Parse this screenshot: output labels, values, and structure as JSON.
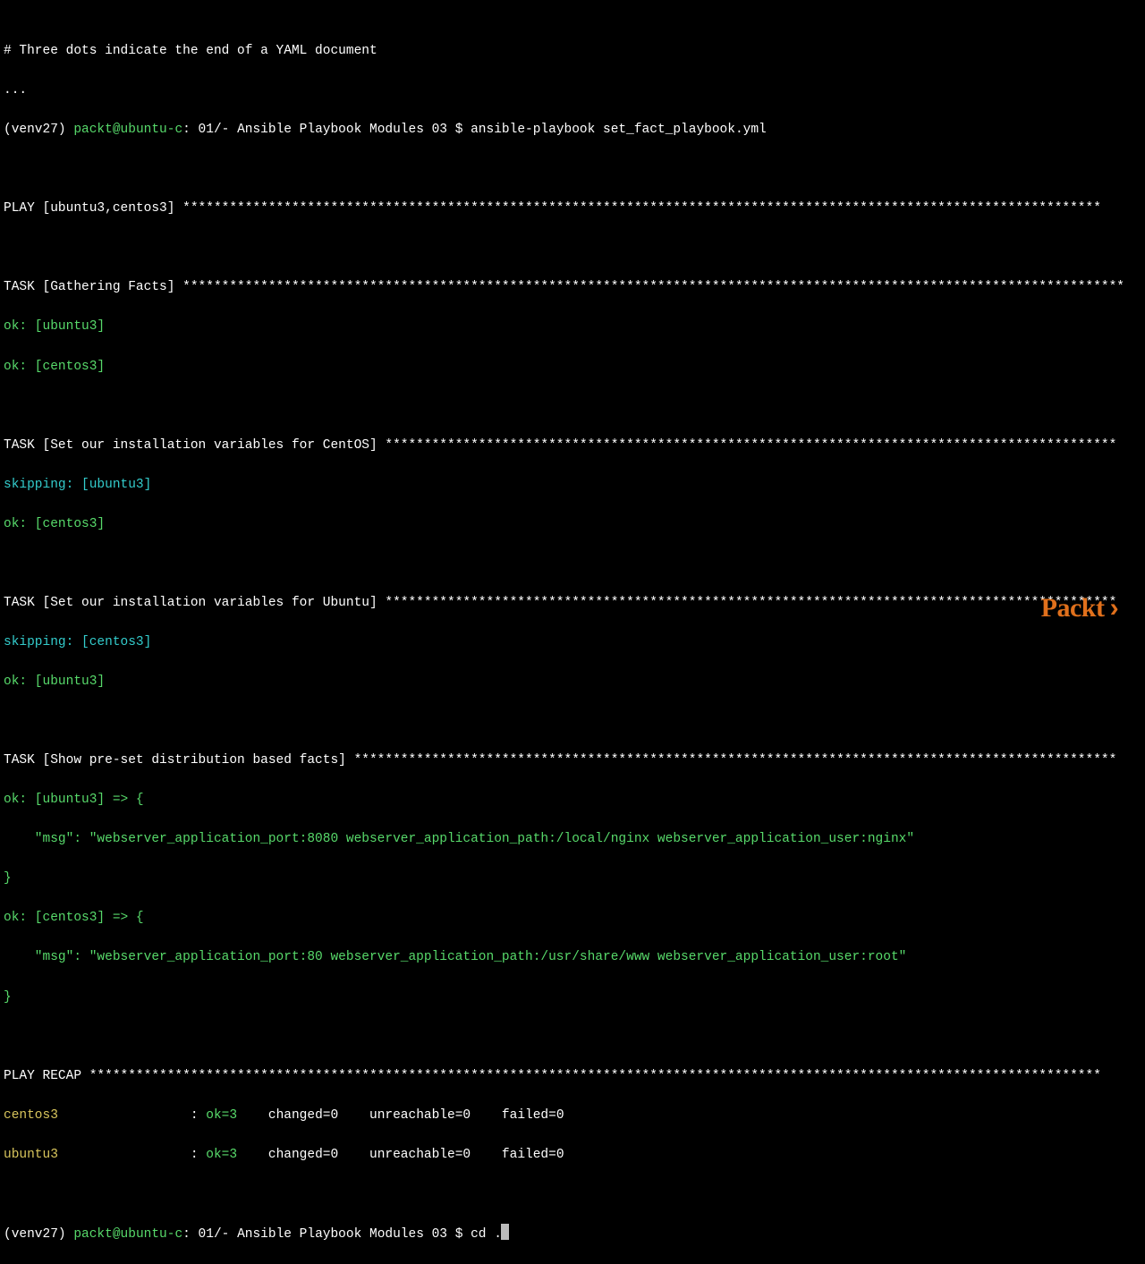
{
  "comment_line": "# Three dots indicate the end of a YAML document",
  "dots_line": "...",
  "prompt": {
    "venv": "(venv27) ",
    "user_host": "packt@ubuntu-c",
    "path_label": ": 01/- Ansible Playbook Modules 03 $ ",
    "command1": "ansible-playbook set_fact_playbook.yml",
    "command2": "cd ."
  },
  "play_header": "PLAY [ubuntu3,centos3] ",
  "task1": {
    "header": "TASK [Gathering Facts] ",
    "r1": "ok: [ubuntu3]",
    "r2": "ok: [centos3]"
  },
  "task2": {
    "header": "TASK [Set our installation variables for CentOS] ",
    "r1": "skipping: [ubuntu3]",
    "r2": "ok: [centos3]"
  },
  "task3": {
    "header": "TASK [Set our installation variables for Ubuntu] ",
    "r1": "skipping: [centos3]",
    "r2": "ok: [ubuntu3]"
  },
  "task4": {
    "header": "TASK [Show pre-set distribution based facts] ",
    "o1_open": "ok: [ubuntu3] => {",
    "o1_msg": "    \"msg\": \"webserver_application_port:8080 webserver_application_path:/local/nginx webserver_application_user:nginx\"",
    "o1_close": "}",
    "o2_open": "ok: [centos3] => {",
    "o2_msg": "    \"msg\": \"webserver_application_port:80 webserver_application_path:/usr/share/www webserver_application_user:root\"",
    "o2_close": "}"
  },
  "recap": {
    "header": "PLAY RECAP ",
    "rows": [
      {
        "host": "centos3",
        "ok": "ok=3",
        "rest": "    changed=0    unreachable=0    failed=0"
      },
      {
        "host": "ubuntu3",
        "ok": "ok=3",
        "rest": "    changed=0    unreachable=0    failed=0"
      }
    ]
  },
  "stars_long": "**********************************************************************************************************************",
  "stars_med1": "*************************************************************************************************************************",
  "stars_med2": "**********************************************************************************************",
  "stars_med3": "**********************************************************************************************",
  "stars_med4": "**************************************************************************************************",
  "stars_recap": "**********************************************************************************************************************************",
  "recap_pad": "                 : ",
  "brand": "Packt"
}
